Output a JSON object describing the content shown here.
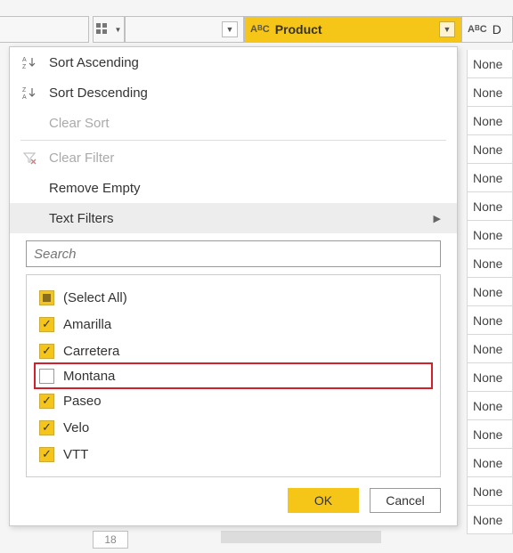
{
  "columns": {
    "product_label": "Product",
    "last_label": "D"
  },
  "rows": {
    "none_value": "None",
    "bottom_row_index": "18",
    "count": 17
  },
  "menu": {
    "sort_asc": "Sort Ascending",
    "sort_desc": "Sort Descending",
    "clear_sort": "Clear Sort",
    "clear_filter": "Clear Filter",
    "remove_empty": "Remove Empty",
    "text_filters": "Text Filters"
  },
  "search": {
    "placeholder": "Search"
  },
  "filter_values": {
    "select_all": "(Select All)",
    "items": [
      "Amarilla",
      "Carretera",
      "Montana",
      "Paseo",
      "Velo",
      "VTT"
    ],
    "unchecked_index": 2
  },
  "buttons": {
    "ok": "OK",
    "cancel": "Cancel"
  }
}
